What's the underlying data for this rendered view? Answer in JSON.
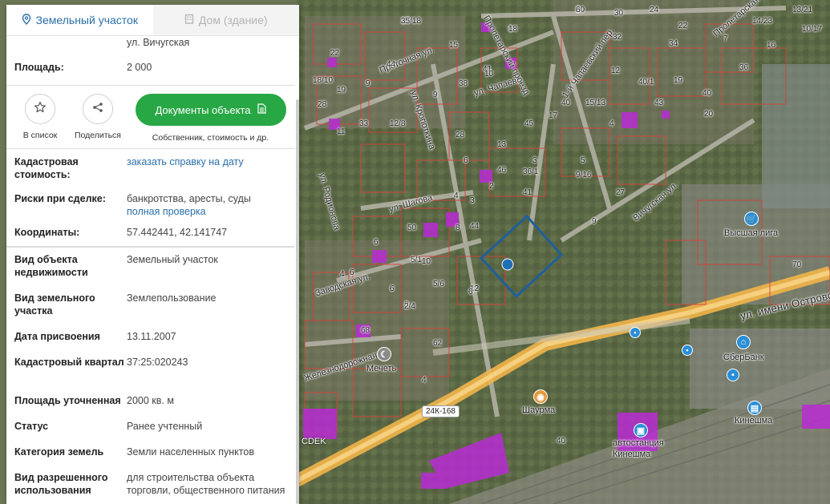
{
  "tabs": {
    "land": "Земельный участок",
    "house": "Дом (здание)"
  },
  "top": {
    "street": "ул. Вичугская",
    "area_label": "Площадь:",
    "area_value": "2 000"
  },
  "actions": {
    "favorite": "В список",
    "share": "Поделиться",
    "docs_button": "Документы объекта",
    "docs_sub": "Собственник, стоимость и др."
  },
  "rows": [
    {
      "key": "Кадастровая стоимость:",
      "value": "",
      "link": "заказать справку на дату"
    },
    {
      "key": "Риски при сделке:",
      "value": "банкротства, аресты, суды",
      "link": "полная проверка"
    },
    {
      "key": "Координаты:",
      "value": "57.442441, 42.141747",
      "link": ""
    },
    {
      "key": "Вид объекта недвижимости",
      "value": "Земельный участок",
      "link": ""
    },
    {
      "key": "Вид земельного участка",
      "value": "Землепользование",
      "link": ""
    },
    {
      "key": "Дата присвоения",
      "value": "13.11.2007",
      "link": ""
    },
    {
      "key": "Кадастровый квартал",
      "value": "37:25:020243",
      "link": ""
    },
    {
      "key": "Площадь уточненная",
      "value": "2000 кв. м",
      "link": ""
    },
    {
      "key": "Статус",
      "value": "Ранее учтенный",
      "link": ""
    },
    {
      "key": "Категория земель",
      "value": "Земли населенных пунктов",
      "link": ""
    },
    {
      "key": "Вид разрешенного использования",
      "value": "для строительства объекта торговли, общественного питания",
      "link": ""
    }
  ],
  "map": {
    "roads": {
      "main": "ул. имени Островского",
      "vichugskaya": "Вичугская ул.",
      "kropotkina": "ул. Кропоткина",
      "chapaeva": "ул. Чапаева",
      "shagova": "ул. Шагова",
      "zavodskaya": "Заводская ул.",
      "zheleznodorozhnaya": "Железнодорожная ул.",
      "rodionova": "ул. Родионова",
      "proezd": "Пролетарский проезд",
      "proletarskaya": "Пролетарская ул.",
      "pereulok": "1-й Чапаевский пер.",
      "protochnaya": "Проточная ул."
    },
    "pois": {
      "vysshaya_liga": "Высшая лига",
      "sberbank": "СберБанк",
      "shaurma": "Шаурма",
      "mechet": "Мечеть",
      "avtostanciya": "автостанция",
      "kineshma": "Кинешма",
      "kineshma_station": "Кинешма",
      "cdek": "CDEK"
    },
    "road_shield": "24К-168",
    "house_numbers": [
      "20",
      "17/18",
      "6",
      "30",
      "24",
      "22",
      "13/21",
      "15",
      "10/17",
      "14/23",
      "7",
      "32",
      "34",
      "16",
      "22",
      "18/10",
      "9",
      "44",
      "41",
      "36",
      "10",
      "38",
      "19",
      "40",
      "9",
      "40/1",
      "12",
      "28",
      "19",
      "40",
      "15/13",
      "43",
      "33",
      "28",
      "17",
      "20",
      "13",
      "11",
      "12/8",
      "4",
      "45",
      "6",
      "41",
      "3",
      "6",
      "36/1",
      "2",
      "9",
      "5",
      "4",
      "50",
      "27",
      "44",
      "5/1",
      "3",
      "46",
      "10",
      "6",
      "5/6",
      "3",
      "8",
      "12",
      "6",
      "2/4",
      "6",
      "4",
      "62",
      "9/16",
      "4",
      "68",
      "40",
      "70",
      "6",
      "35",
      "18"
    ]
  },
  "colors": {
    "accent": "#2a6fa8",
    "green": "#28a745",
    "parcel_outline": "#1f5f99"
  }
}
